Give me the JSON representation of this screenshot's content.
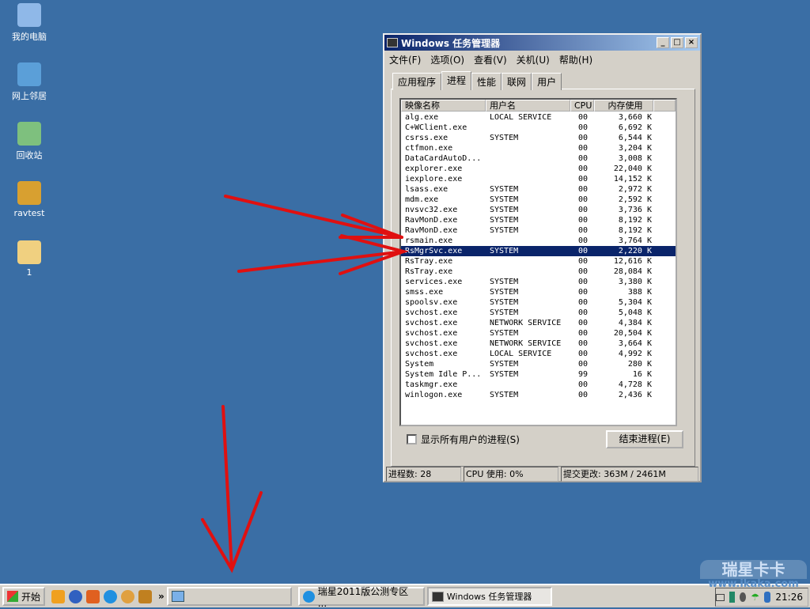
{
  "desktop": {
    "icons": [
      {
        "label": "我的电脑",
        "color": "#8fb8e8"
      },
      {
        "label": "网上邻居",
        "color": "#5b9fd8"
      },
      {
        "label": "回收站",
        "color": "#7ec07e"
      },
      {
        "label": "ravtest",
        "color": "#d8a030"
      },
      {
        "label": "1",
        "color": "#f0d080"
      }
    ]
  },
  "window": {
    "title": "Windows 任务管理器",
    "controls": [
      "_",
      "□",
      "×"
    ],
    "menu": [
      "文件(F)",
      "选项(O)",
      "查看(V)",
      "关机(U)",
      "帮助(H)"
    ],
    "tabs": [
      "应用程序",
      "进程",
      "性能",
      "联网",
      "用户"
    ],
    "active_tab": 1,
    "columns": [
      "映像名称",
      "用户名",
      "CPU",
      "内存使用"
    ],
    "processes": [
      [
        "alg.exe",
        "LOCAL SERVICE",
        "00",
        "3,660 K"
      ],
      [
        "C+WClient.exe",
        "",
        "00",
        "6,692 K"
      ],
      [
        "csrss.exe",
        "SYSTEM",
        "00",
        "6,544 K"
      ],
      [
        "ctfmon.exe",
        "",
        "00",
        "3,204 K"
      ],
      [
        "DataCardAutoD...",
        "",
        "00",
        "3,008 K"
      ],
      [
        "explorer.exe",
        "",
        "00",
        "22,040 K"
      ],
      [
        "iexplore.exe",
        "",
        "00",
        "14,152 K"
      ],
      [
        "lsass.exe",
        "SYSTEM",
        "00",
        "2,972 K"
      ],
      [
        "mdm.exe",
        "SYSTEM",
        "00",
        "2,592 K"
      ],
      [
        "nvsvc32.exe",
        "SYSTEM",
        "00",
        "3,736 K"
      ],
      [
        "RavMonD.exe",
        "SYSTEM",
        "00",
        "8,192 K"
      ],
      [
        "RavMonD.exe",
        "SYSTEM",
        "00",
        "8,192 K"
      ],
      [
        "rsmain.exe",
        "",
        "00",
        "3,764 K"
      ],
      [
        "RsMgrSvc.exe",
        "SYSTEM",
        "00",
        "2,220 K"
      ],
      [
        "RsTray.exe",
        "",
        "00",
        "12,616 K"
      ],
      [
        "RsTray.exe",
        "",
        "00",
        "28,084 K"
      ],
      [
        "services.exe",
        "SYSTEM",
        "00",
        "3,380 K"
      ],
      [
        "smss.exe",
        "SYSTEM",
        "00",
        "388 K"
      ],
      [
        "spoolsv.exe",
        "SYSTEM",
        "00",
        "5,304 K"
      ],
      [
        "svchost.exe",
        "SYSTEM",
        "00",
        "5,048 K"
      ],
      [
        "svchost.exe",
        "NETWORK SERVICE",
        "00",
        "4,384 K"
      ],
      [
        "svchost.exe",
        "SYSTEM",
        "00",
        "20,504 K"
      ],
      [
        "svchost.exe",
        "NETWORK SERVICE",
        "00",
        "3,664 K"
      ],
      [
        "svchost.exe",
        "LOCAL SERVICE",
        "00",
        "4,992 K"
      ],
      [
        "System",
        "SYSTEM",
        "00",
        "280 K"
      ],
      [
        "System Idle P...",
        "SYSTEM",
        "99",
        "16 K"
      ],
      [
        "taskmgr.exe",
        "",
        "00",
        "4,728 K"
      ],
      [
        "winlogon.exe",
        "SYSTEM",
        "00",
        "2,436 K"
      ]
    ],
    "selected_index": 13,
    "show_all_label": "显示所有用户的进程(S)",
    "end_process_label": "结束进程(E)",
    "status": {
      "processes": "进程数: 28",
      "cpu": "CPU 使用: 0%",
      "commit": "提交更改: 363M / 2461M"
    }
  },
  "taskbar": {
    "start": "开始",
    "more": "»",
    "tasks": [
      "",
      "瑞星2011版公测专区 ...",
      "Windows 任务管理器"
    ],
    "clock": "21:26"
  },
  "watermark": {
    "text": "瑞星卡卡",
    "url": "www.ikaka.com"
  },
  "annotation_color": "#e01010"
}
